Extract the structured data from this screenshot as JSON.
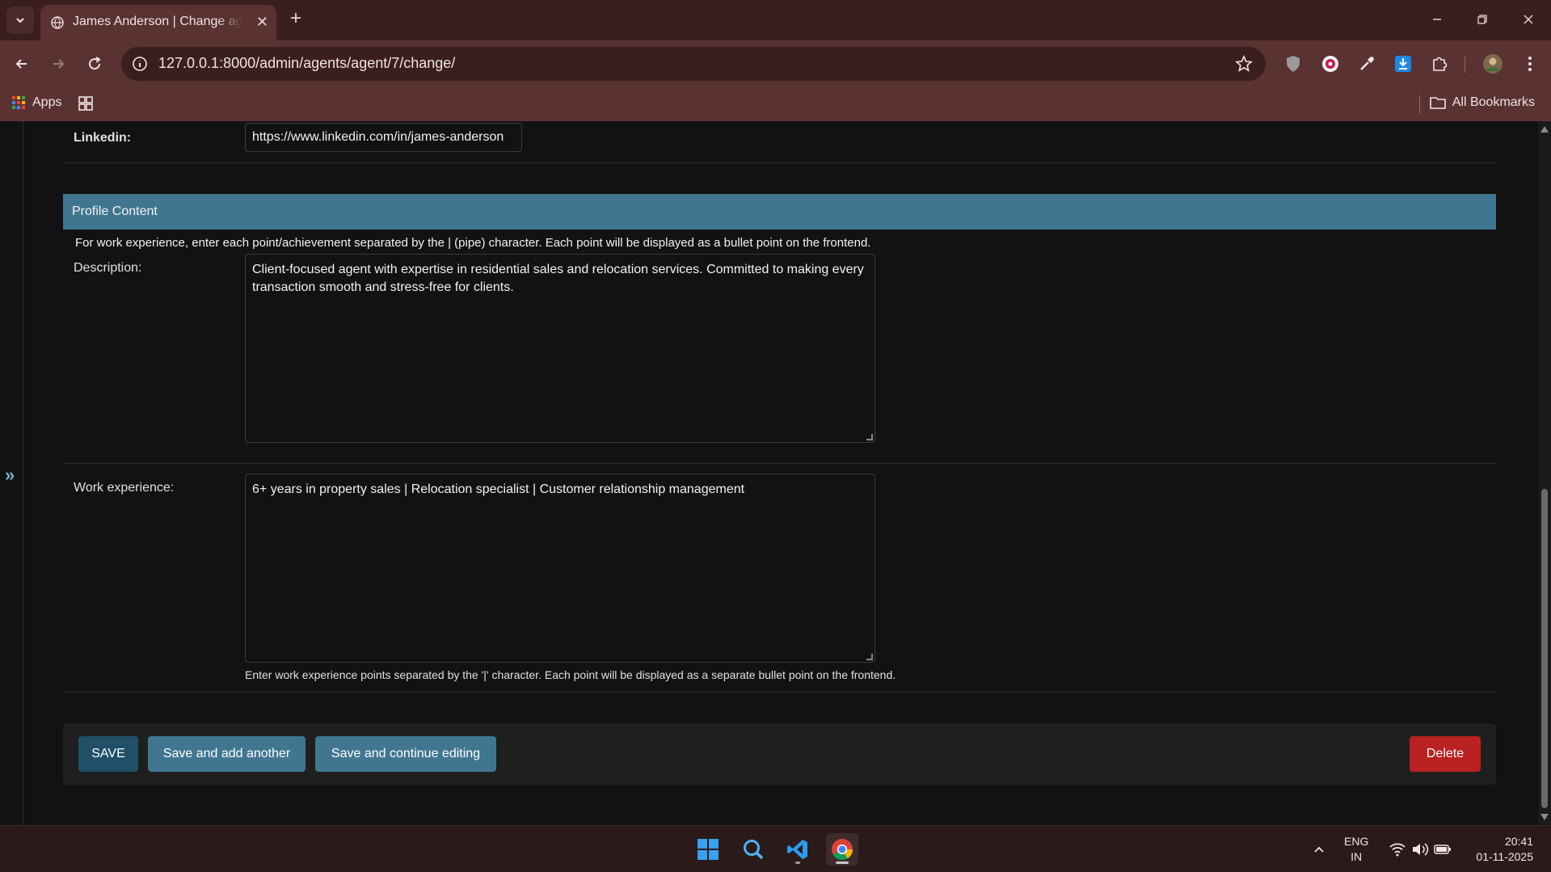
{
  "browser": {
    "tab_title": "James Anderson | Change agent",
    "url": "127.0.0.1:8000/admin/agents/agent/7/change/",
    "bookmarks": {
      "apps_label": "Apps",
      "all_bookmarks_label": "All Bookmarks"
    }
  },
  "form": {
    "linkedin": {
      "label": "Linkedin:",
      "value": "https://www.linkedin.com/in/james-anderson"
    },
    "fieldset": {
      "title": "Profile Content",
      "description": "For work experience, enter each point/achievement separated by the | (pipe) character. Each point will be displayed as a bullet point on the frontend."
    },
    "description_field": {
      "label": "Description:",
      "value": "Client-focused agent with expertise in residential sales and relocation services. Committed to making every transaction smooth and stress-free for clients."
    },
    "work_experience_field": {
      "label": "Work experience:",
      "value": "6+ years in property sales | Relocation specialist | Customer relationship management",
      "help": "Enter work experience points separated by the '|' character. Each point will be displayed as a separate bullet point on the frontend."
    },
    "actions": {
      "save": "SAVE",
      "save_add": "Save and add another",
      "save_continue": "Save and continue editing",
      "delete": "Delete"
    }
  },
  "sidebar": {
    "toggle_glyph": "»"
  },
  "taskbar": {
    "lang_top": "ENG",
    "lang_bottom": "IN",
    "time": "20:41",
    "date": "01-11-2025"
  },
  "colors": {
    "header_blue": "#417690",
    "save_blue": "#205067",
    "delete_red": "#ba2121",
    "chrome_dark": "#3b1f1f",
    "chrome_mid": "#5a3232"
  }
}
